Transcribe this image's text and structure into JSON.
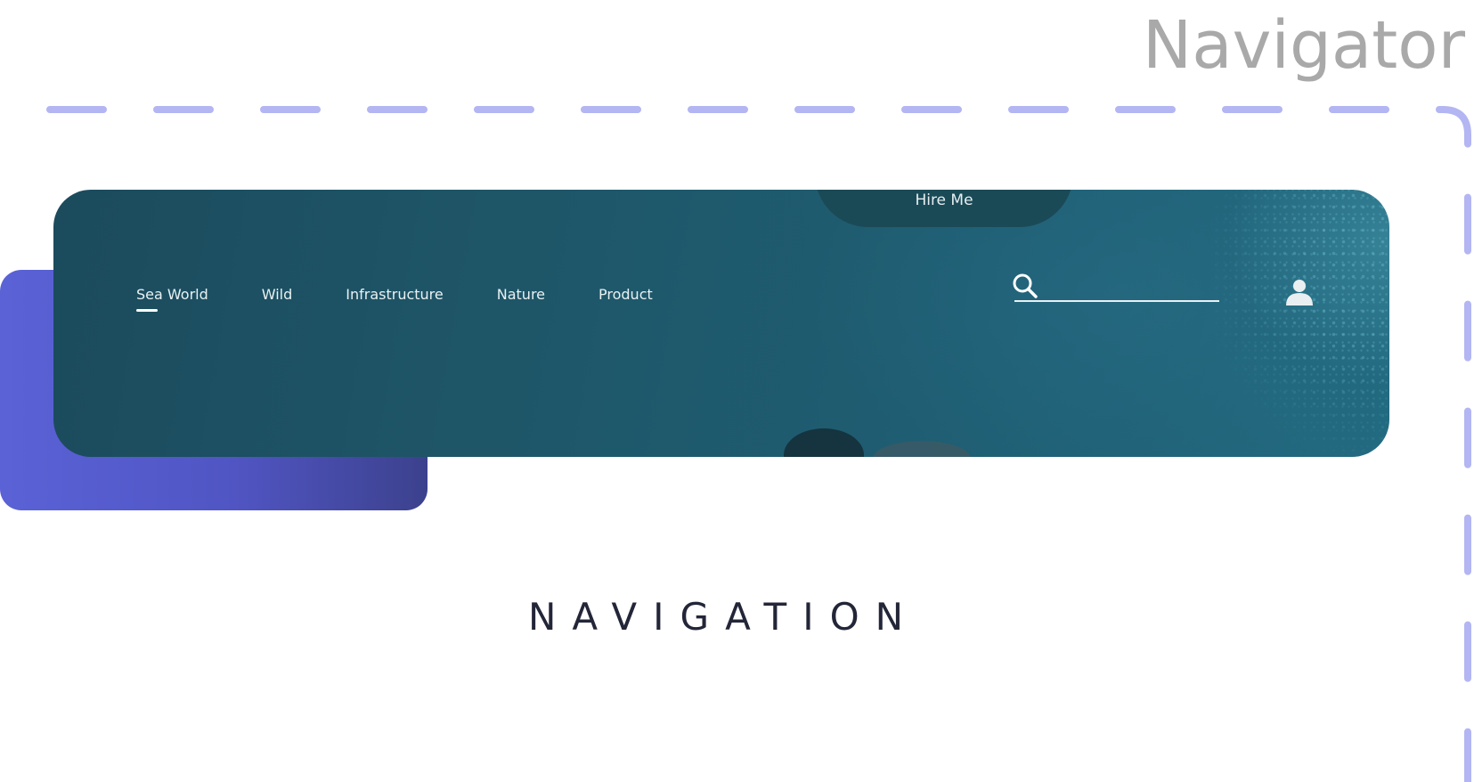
{
  "page": {
    "heading": "Navigator",
    "section_label": "NAVIGATION"
  },
  "navbar": {
    "hire_button": "Hire Me",
    "links": [
      {
        "label": "Sea World",
        "active": true
      },
      {
        "label": "Wild",
        "active": false
      },
      {
        "label": "Infrastructure",
        "active": false
      },
      {
        "label": "Nature",
        "active": false
      },
      {
        "label": "Product",
        "active": false
      }
    ],
    "search": {
      "value": "",
      "placeholder": "",
      "icon": "search-icon"
    },
    "account_icon": "user-icon"
  },
  "colors": {
    "guide_dash": "#b3b6f2",
    "accent_start": "#5a62d6",
    "accent_end": "#3c418d",
    "card_dark": "#1b4b5d",
    "card_light": "#226a80",
    "heading_grey": "#a9a9a9",
    "label_dark": "#232638"
  }
}
